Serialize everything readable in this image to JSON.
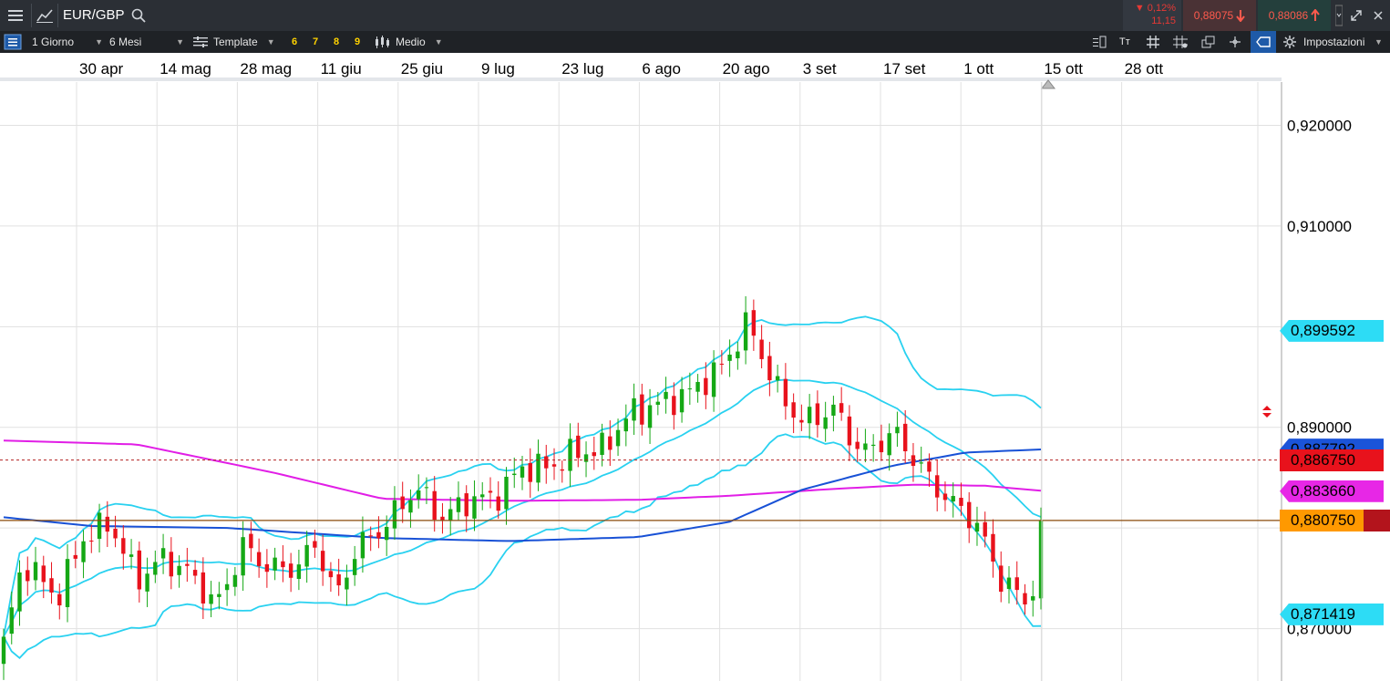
{
  "header": {
    "menu_icon": "hamburger-icon",
    "chart_icon": "line-chart-icon",
    "symbol": "EUR/GBP",
    "search_icon": "search-icon",
    "change_pct": "▼ 0,12%",
    "change_val": "11,15",
    "sell_price": "0,88075",
    "buy_price": "0,88086",
    "dropdown_icon": "chevron-down-icon",
    "expand_icon": "expand-icon",
    "close_icon": "close-icon"
  },
  "toolbar": {
    "interval": "1 Giorno",
    "range": "6 Mesi",
    "template": "Template",
    "fav_1": "6",
    "fav_2": "7",
    "fav_3": "8",
    "fav_4": "9",
    "chart_type": "Medio",
    "settings": "Impostazioni"
  },
  "chart_data": {
    "type": "candlestick",
    "symbol": "EUR/GBP",
    "x_tick_labels": [
      "30 apr",
      "14 mag",
      "28 mag",
      "11 giu",
      "25 giu",
      "9 lug",
      "23 lug",
      "6 ago",
      "20 ago",
      "3 set",
      "17 set",
      "1 ott",
      "15 ott",
      "28 ott"
    ],
    "y_tick_labels": [
      "0,920000",
      "0,910000",
      "0,890000",
      "0,870000"
    ],
    "ylim": [
      0.8648,
      0.9243
    ],
    "grid": true,
    "up_color": "#15a815",
    "down_color": "#e8121c",
    "indicators": [
      {
        "name": "Bollinger upper",
        "color": "#29d1f0"
      },
      {
        "name": "Bollinger middle",
        "color": "#29d1f0"
      },
      {
        "name": "Bollinger lower",
        "color": "#29d1f0"
      },
      {
        "name": "Moving average blue",
        "color": "#1851d6"
      },
      {
        "name": "Moving average magenta",
        "color": "#e11ee6"
      }
    ],
    "price_labels": [
      {
        "text": "0,899592",
        "value": 0.899592,
        "bg": "#2ddcf5"
      },
      {
        "text": "0,887792",
        "value": 0.88779,
        "bg": "#1b54d9"
      },
      {
        "text": "0,886750",
        "value": 0.88675,
        "bg": "#e8121c"
      },
      {
        "text": "0,883660",
        "value": 0.88366,
        "bg": "#e727e6"
      },
      {
        "text": "0,880750",
        "value": 0.88075,
        "bg": "#ff9900"
      },
      {
        "text": "0,871419",
        "value": 0.871419,
        "bg": "#2ddcf5"
      }
    ],
    "reference_lines": {
      "current_price": 0.88075,
      "dashed_level": 0.88675
    }
  }
}
